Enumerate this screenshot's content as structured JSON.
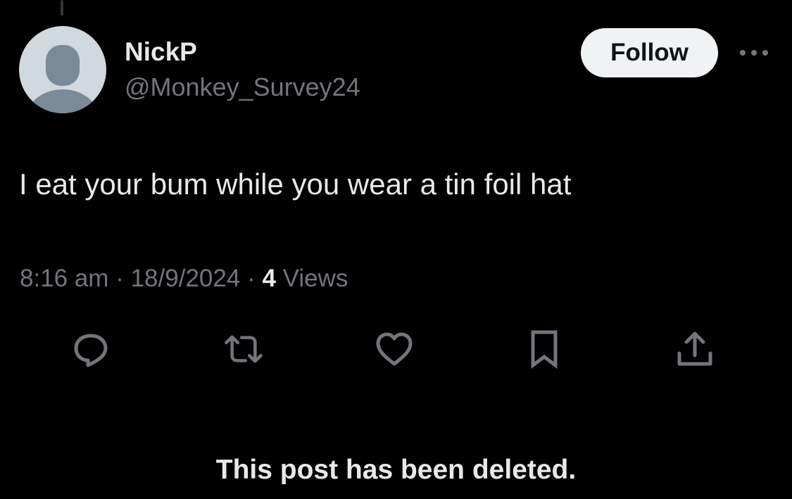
{
  "author": {
    "display_name": "NickP",
    "handle": "@Monkey_Survey24",
    "avatar_icon": "default-avatar-icon",
    "follow_label": "Follow"
  },
  "post": {
    "text": "I eat your bum while you wear a tin foil hat",
    "time": "8:16 am",
    "separator": "·",
    "date": "18/9/2024",
    "views_count": "4",
    "views_label": "Views"
  },
  "actions": [
    {
      "name": "reply",
      "icon": "speech-bubble-icon"
    },
    {
      "name": "repost",
      "icon": "repost-arrows-icon"
    },
    {
      "name": "like",
      "icon": "heart-icon"
    },
    {
      "name": "bookmark",
      "icon": "bookmark-icon"
    },
    {
      "name": "share",
      "icon": "share-upload-icon"
    }
  ],
  "notice": {
    "text": "This post has been deleted."
  },
  "colors": {
    "background": "#000000",
    "primary_text": "#e7e9ea",
    "secondary_text": "#71767b",
    "follow_button_bg": "#eff3f4",
    "avatar_bg": "#cfd9de",
    "avatar_figure": "#7b8a97"
  }
}
